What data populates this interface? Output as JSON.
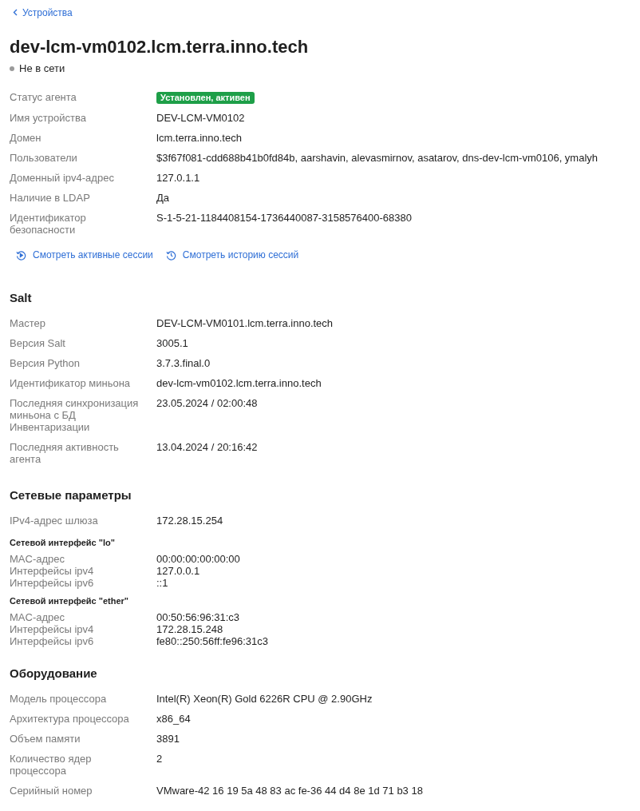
{
  "back_link": "Устройства",
  "title": "dev-lcm-vm0102.lcm.terra.inno.tech",
  "status": {
    "label": "Не в сети",
    "online": false
  },
  "general": [
    {
      "label": "Статус агента",
      "value": "Установлен, активен",
      "kind": "badge"
    },
    {
      "label": "Имя устройства",
      "value": "DEV-LCM-VM0102",
      "kind": "text"
    },
    {
      "label": "Домен",
      "value": "lcm.terra.inno.tech",
      "kind": "text"
    },
    {
      "label": "Пользователи",
      "value": "$3f67f081-cdd688b41b0fd84b, aarshavin, alevasmirnov, asatarov, dns-dev-lcm-vm0106, ymalyh",
      "kind": "text"
    },
    {
      "label": "Доменный ipv4-адрес",
      "value": "127.0.1.1",
      "kind": "text"
    },
    {
      "label": "Наличие в LDAP",
      "value": "Да",
      "kind": "text"
    },
    {
      "label": "Идентификатор безопасности",
      "value": "S-1-5-21-1184408154-1736440087-3158576400-68380",
      "kind": "text"
    }
  ],
  "session_links": [
    {
      "label": "Смотреть активные сессии",
      "kind": "active"
    },
    {
      "label": "Смотреть историю сессий",
      "kind": "history"
    }
  ],
  "sections": [
    {
      "title": "Salt",
      "rows": [
        {
          "label": "Мастер",
          "value": "DEV-LCM-VM0101.lcm.terra.inno.tech"
        },
        {
          "label": "Версия Salt",
          "value": "3005.1"
        },
        {
          "label": "Версия Python",
          "value": "3.7.3.final.0"
        },
        {
          "label": "Идентификатор миньона",
          "value": "dev-lcm-vm0102.lcm.terra.inno.tech"
        },
        {
          "label": "Последняя синхронизация миньона с БД Инвентаризации",
          "value": "23.05.2024 / 02:00:48"
        },
        {
          "label": "Последняя активность агента",
          "value": "13.04.2024 / 20:16:42"
        }
      ]
    },
    {
      "title": "Сетевые параметры",
      "rows": [
        {
          "label": "IPv4-адрес шлюза",
          "value": "172.28.15.254"
        }
      ],
      "interfaces": [
        {
          "title": "Сетевой интерфейс \"lo\"",
          "rows": [
            {
              "label": "MAC-адрес",
              "value": "00:00:00:00:00:00"
            },
            {
              "label": "Интерфейсы ipv4",
              "value": "127.0.0.1"
            },
            {
              "label": "Интерфейсы ipv6",
              "value": "::1"
            }
          ]
        },
        {
          "title": "Сетевой интерфейс \"ether\"",
          "rows": [
            {
              "label": "MAC-адрес",
              "value": "00:50:56:96:31:c3"
            },
            {
              "label": "Интерфейсы ipv4",
              "value": "172.28.15.248"
            },
            {
              "label": "Интерфейсы ipv6",
              "value": "fe80::250:56ff:fe96:31c3"
            }
          ]
        }
      ]
    },
    {
      "title": "Оборудование",
      "rows": [
        {
          "label": "Модель процессора",
          "value": "Intel(R) Xeon(R) Gold 6226R CPU @ 2.90GHz"
        },
        {
          "label": "Архитектура процессора",
          "value": "x86_64"
        },
        {
          "label": "Объем памяти",
          "value": "3891"
        },
        {
          "label": "Количество ядер процессора",
          "value": "2"
        },
        {
          "label": "Серийный номер",
          "value": "VMware-42 16 19 5a 48 83 ac fe-36 44 d4 8e 1d 71 b3 18"
        }
      ]
    }
  ]
}
